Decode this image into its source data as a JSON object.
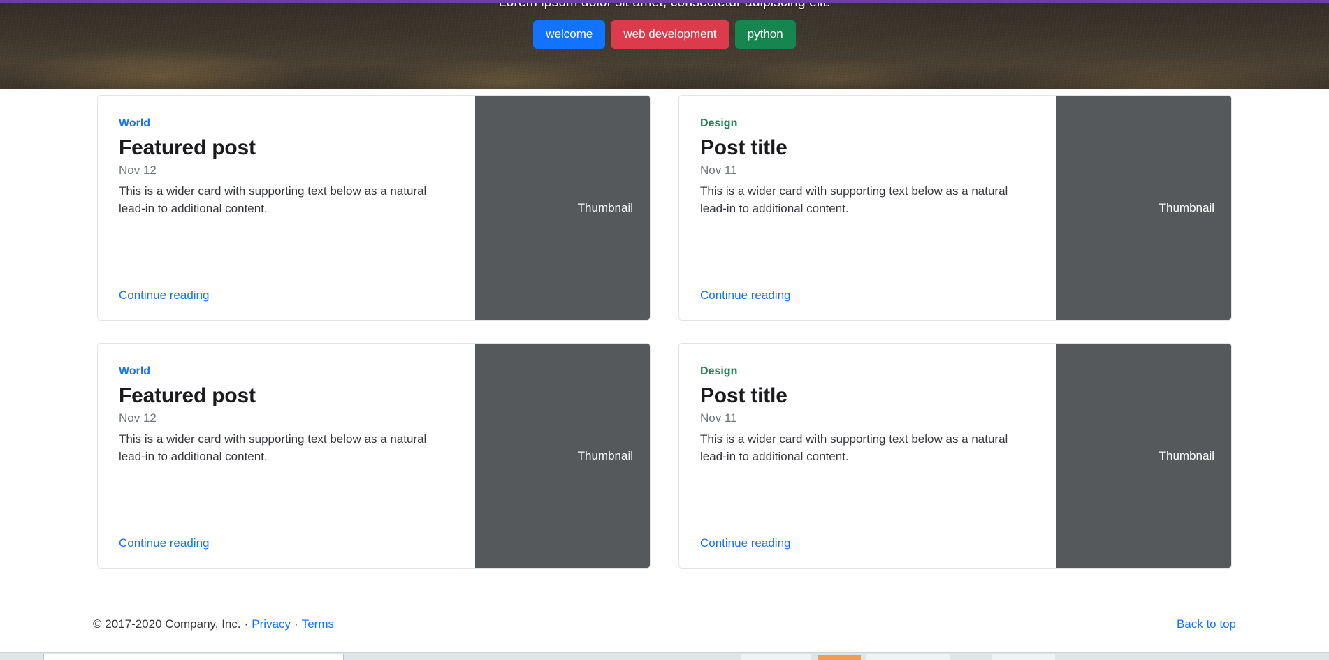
{
  "hero": {
    "caption": "Lorem ipsum dolor sit amet, consectetur adipiscing elit.",
    "buttons": [
      {
        "label": "welcome",
        "variant": "c-primary",
        "color": "#1173ff",
        "name": "hero-button-welcome"
      },
      {
        "label": "web development",
        "variant": "c-danger",
        "color": "#dc3b4c",
        "name": "hero-button-web-development"
      },
      {
        "label": "python",
        "variant": "c-success",
        "color": "#16854f",
        "name": "hero-button-python"
      }
    ],
    "indicators": [
      {
        "active": false
      },
      {
        "active": true
      },
      {
        "active": false
      }
    ]
  },
  "cards": [
    {
      "category": "World",
      "category_class": "cat-world",
      "category_color": "#1173ff",
      "title": "Featured post",
      "date": "Nov 12",
      "text": "This is a wider card with supporting text below as a natural lead-in to additional content.",
      "link_label": "Continue reading",
      "thumbnail_label": "Thumbnail"
    },
    {
      "category": "Design",
      "category_class": "cat-design",
      "category_color": "#16854f",
      "title": "Post title",
      "date": "Nov 11",
      "text": "This is a wider card with supporting text below as a natural lead-in to additional content.",
      "link_label": "Continue reading",
      "thumbnail_label": "Thumbnail"
    },
    {
      "category": "World",
      "category_class": "cat-world",
      "category_color": "#1173ff",
      "title": "Featured post",
      "date": "Nov 12",
      "text": "This is a wider card with supporting text below as a natural lead-in to additional content.",
      "link_label": "Continue reading",
      "thumbnail_label": "Thumbnail"
    },
    {
      "category": "Design",
      "category_class": "cat-design",
      "category_color": "#16854f",
      "title": "Post title",
      "date": "Nov 11",
      "text": "This is a wider card with supporting text below as a natural lead-in to additional content.",
      "link_label": "Continue reading",
      "thumbnail_label": "Thumbnail"
    }
  ],
  "footer": {
    "copyright": "© 2017-2020 Company, Inc.",
    "separator": "·",
    "privacy_label": "Privacy",
    "terms_label": "Terms",
    "back_to_top_label": "Back to top"
  },
  "theme": {
    "link_color": "#1173ff",
    "thumbnail_bg": "#55595c",
    "card_border": "#e3e4e8",
    "browser_accent": "#6f3f9e"
  }
}
